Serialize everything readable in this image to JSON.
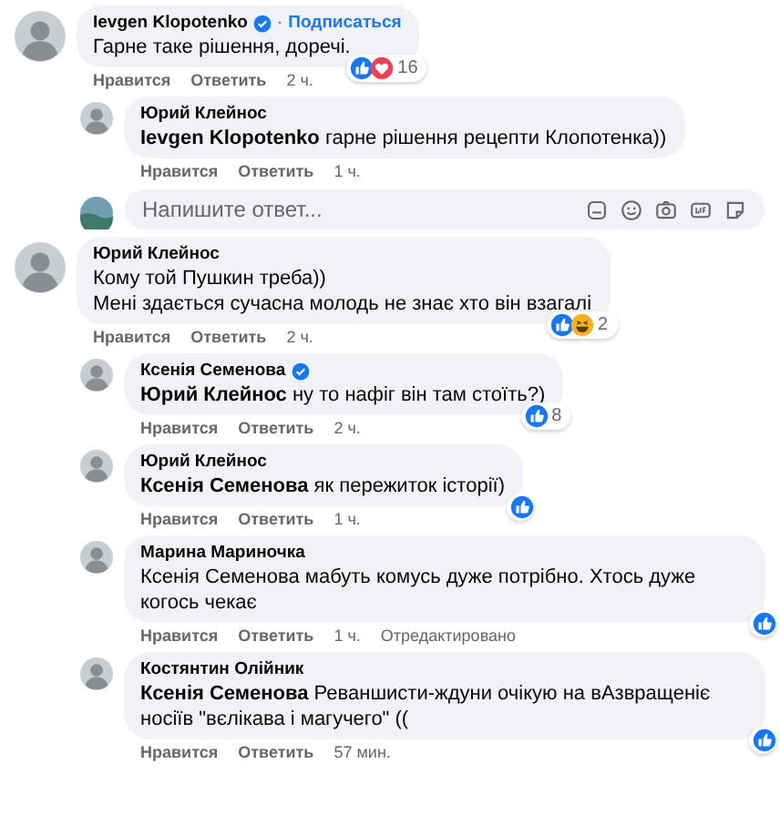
{
  "comments": [
    {
      "author": "Ievgen Klopotenko",
      "verified": true,
      "follow_separator": "·",
      "follow": "Подписаться",
      "text": "Гарне таке рішення, доречі.",
      "reactions": [
        {
          "kind": "like"
        },
        {
          "kind": "love"
        }
      ],
      "reaction_count": "16",
      "actions": {
        "like": "Нравится",
        "reply": "Ответить",
        "time": "2 ч."
      },
      "children": [
        {
          "author": "Юрий Клейнос",
          "text": "**Ievgen Klopotenko** гарне рішення рецепти Клопотенка))",
          "actions": {
            "like": "Нравится",
            "reply": "Ответить",
            "time": "1 ч."
          }
        }
      ],
      "reply_box": {
        "placeholder": "Напишите ответ..."
      }
    },
    {
      "author": "Юрий Клейнос",
      "text": "Кому той Пушкин треба))\nМені здається сучасна молодь не знає хто він взагалі",
      "reactions": [
        {
          "kind": "like"
        },
        {
          "kind": "haha"
        }
      ],
      "reaction_count": "2",
      "actions": {
        "like": "Нравится",
        "reply": "Ответить",
        "time": "2 ч."
      },
      "children": [
        {
          "author": "Ксенія Семенова",
          "verified": true,
          "text": "**Юрий Клейнос** ну то нафіг він там стоїть?)",
          "reactions": [
            {
              "kind": "like"
            }
          ],
          "reaction_count": "8",
          "actions": {
            "like": "Нравится",
            "reply": "Ответить",
            "time": "2 ч."
          }
        },
        {
          "author": "Юрий Клейнос",
          "text": "**Ксенія Семенова** як пережиток історії)",
          "reactions": [
            {
              "kind": "like"
            }
          ],
          "actions": {
            "like": "Нравится",
            "reply": "Ответить",
            "time": "1 ч."
          }
        },
        {
          "author": "Марина Мариночка",
          "text": "Ксенія Семенова мабуть комусь дуже потрібно. Хтось дуже когось чекає",
          "reactions": [
            {
              "kind": "like"
            }
          ],
          "actions": {
            "like": "Нравится",
            "reply": "Ответить",
            "time": "1 ч.",
            "edited": "Отредактировано"
          }
        },
        {
          "author": "Костянтин Олійник",
          "text": "**Ксенія Семенова** Реваншисти-ждуни очікую на вАзвращеніє носіїв \"вєлікава і магучего\" ((",
          "reactions": [
            {
              "kind": "like"
            }
          ],
          "actions": {
            "like": "Нравится",
            "reply": "Ответить",
            "time": "57 мин."
          }
        }
      ]
    }
  ]
}
